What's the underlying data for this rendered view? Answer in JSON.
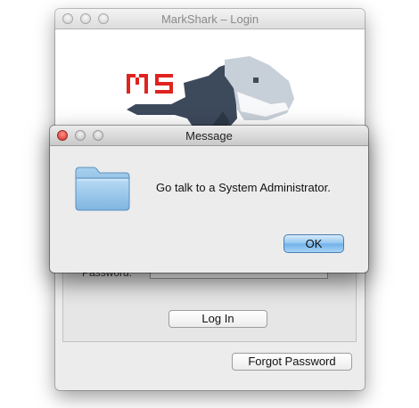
{
  "login_window": {
    "title": "MarkShark – Login",
    "logo_text": "MS",
    "password_label": "Password:",
    "login_button": "Log In",
    "forgot_button": "Forgot Password"
  },
  "dialog": {
    "title": "Message",
    "message": "Go talk to a System Administrator.",
    "ok_button": "OK",
    "icon": "folder-icon"
  },
  "colors": {
    "logo_red": "#e0231f",
    "shark_dark": "#3d4a5c",
    "shark_light": "#c7cfd8",
    "ok_blue": "#7ab8ec",
    "close_red": "#e0463e"
  }
}
